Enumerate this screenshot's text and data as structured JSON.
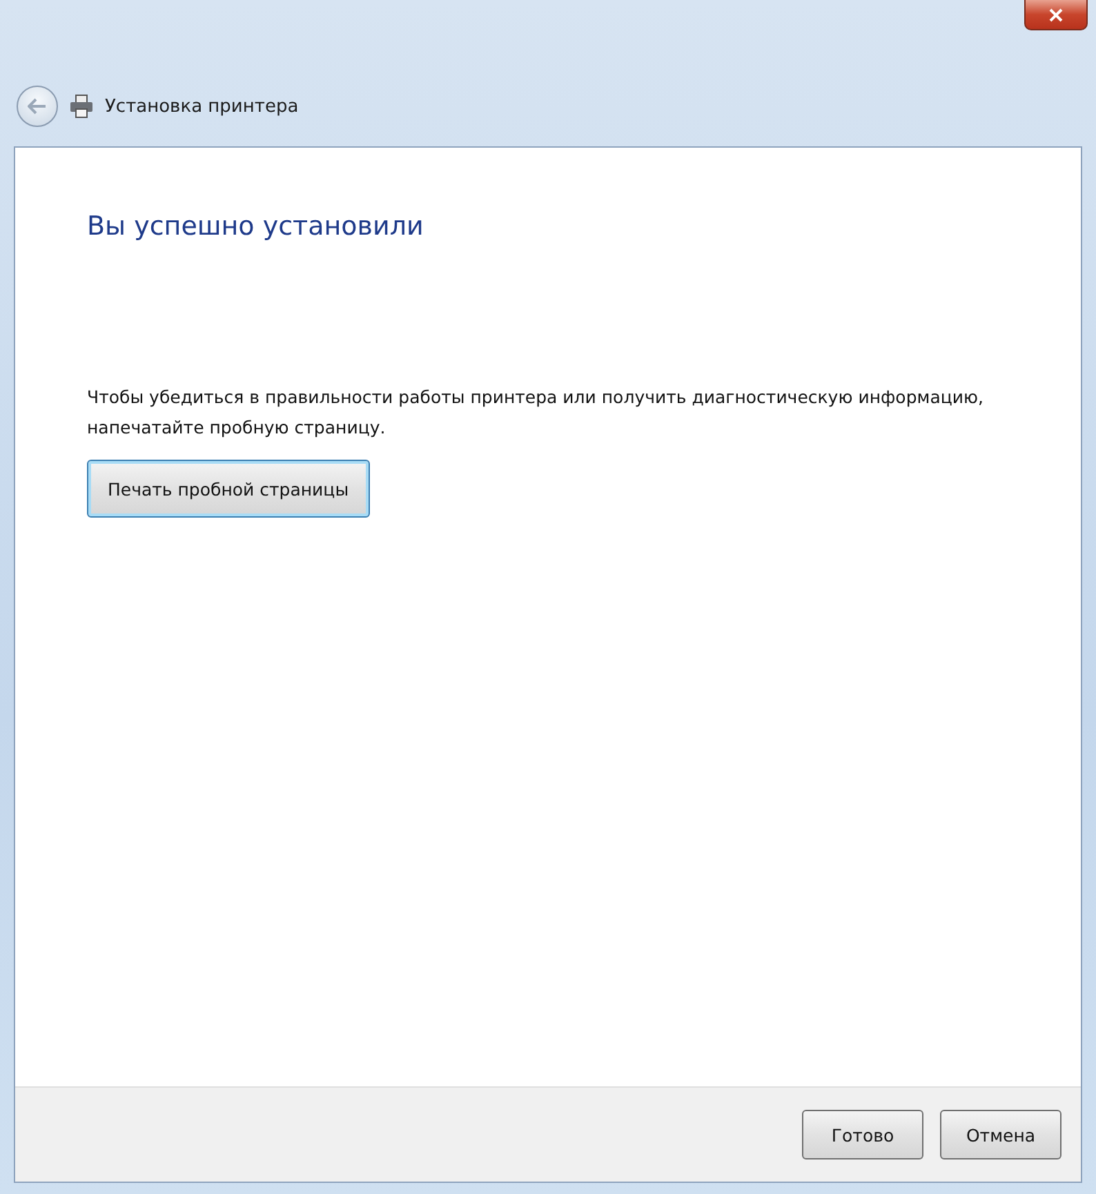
{
  "window": {
    "title": "Установка принтера"
  },
  "heading": "Вы успешно установили",
  "description": "Чтобы убедиться в правильности работы принтера или получить диагностическую информацию, напечатайте пробную страницу.",
  "test_page_button": {
    "label": "Печать пробной страницы",
    "focused": true
  },
  "buttons": [
    {
      "label": "Готово"
    },
    {
      "label": "Отмена"
    }
  ]
}
